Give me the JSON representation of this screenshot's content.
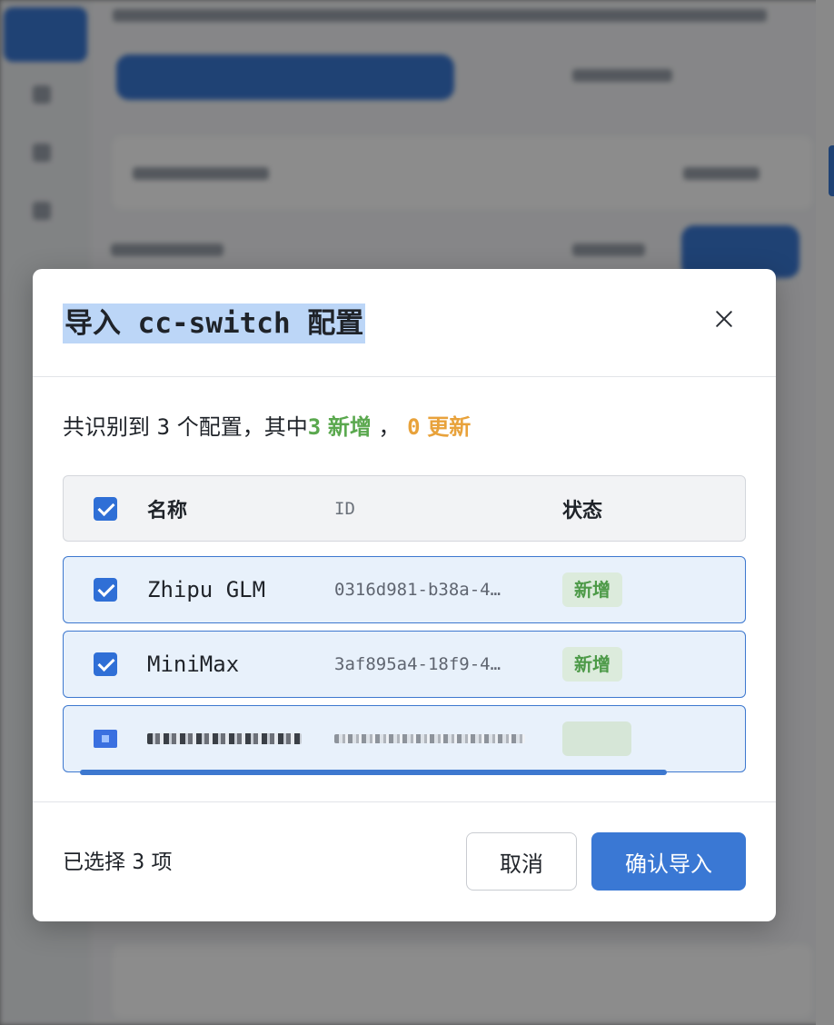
{
  "dialog": {
    "title": "导入 cc-switch 配置",
    "summary": {
      "prefix": "共识别到",
      "total": "3",
      "middle": "个配置，其中",
      "new_count": "3",
      "new_label": "新增",
      "separator": "，",
      "update_count": "0",
      "update_label": "更新"
    },
    "table": {
      "headers": {
        "name": "名称",
        "id": "ID",
        "status": "状态"
      },
      "rows": [
        {
          "name": "Zhipu GLM",
          "id": "0316d981-b38a-4…",
          "status": "新增",
          "checked": true
        },
        {
          "name": "MiniMax",
          "id": "3af895a4-18f9-4…",
          "status": "新增",
          "checked": true
        },
        {
          "name": "",
          "id": "",
          "status": "",
          "checked": true,
          "obscured": true
        }
      ]
    },
    "footer": {
      "selected_prefix": "已选择",
      "selected_count": "3",
      "selected_suffix": "项",
      "cancel_label": "取消",
      "confirm_label": "确认导入"
    }
  },
  "colors": {
    "accent": "#3a78d4",
    "new_green": "#5aa84e",
    "update_orange": "#e8a23b",
    "title_highlight": "#bcd6f7"
  },
  "icons": {
    "close": "close-icon",
    "check": "checkbox-checked-icon"
  }
}
